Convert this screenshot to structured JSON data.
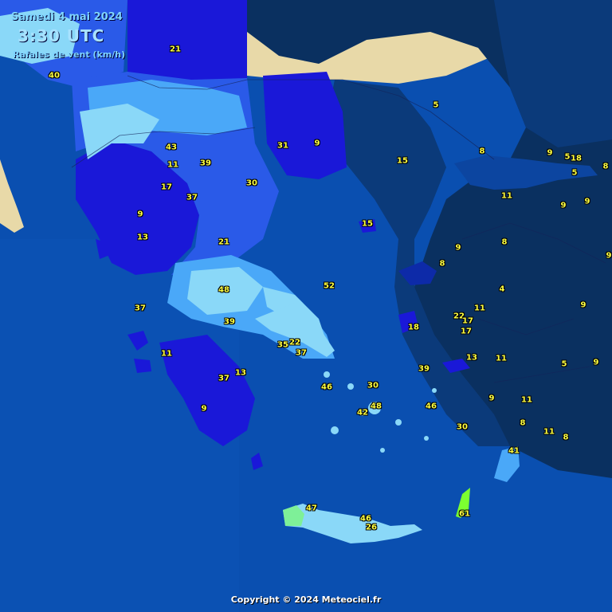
{
  "header": {
    "date": "Samedi 4 mai 2024",
    "time": "3:30 UTC",
    "variable": "Rafales de vent (km/h)"
  },
  "copyright": "Copyright © 2024 Meteociel.fr",
  "colors": {
    "sea": "#0a4fb0",
    "land_outside": "#e8d9a8",
    "very_dark_navy": "#0a3060",
    "dark_navy": "#0b3a7a",
    "navy": "#0d2aa8",
    "blue_dark": "#1a18d8",
    "blue_mid": "#2a5ae8",
    "blue_light": "#4aa8f8",
    "cyan": "#8ad8f8",
    "mint": "#7ef098",
    "green": "#7cff30",
    "label": "#ffff40"
  },
  "gust_labels": [
    {
      "v": "40"
    },
    {
      "v": "21"
    },
    {
      "v": "5"
    },
    {
      "v": "43"
    },
    {
      "v": "11"
    },
    {
      "v": "39"
    },
    {
      "v": "31"
    },
    {
      "v": "9"
    },
    {
      "v": "15"
    },
    {
      "v": "8"
    },
    {
      "v": "9"
    },
    {
      "v": "5"
    },
    {
      "v": "18"
    },
    {
      "v": "8"
    },
    {
      "v": "5"
    },
    {
      "v": "17"
    },
    {
      "v": "37"
    },
    {
      "v": "30"
    },
    {
      "v": "11"
    },
    {
      "v": "9"
    },
    {
      "v": "9"
    },
    {
      "v": "9"
    },
    {
      "v": "13"
    },
    {
      "v": "21"
    },
    {
      "v": "15"
    },
    {
      "v": "8"
    },
    {
      "v": "9"
    },
    {
      "v": "8"
    },
    {
      "v": "9"
    },
    {
      "v": "48"
    },
    {
      "v": "52"
    },
    {
      "v": "4"
    },
    {
      "v": "37"
    },
    {
      "v": "11"
    },
    {
      "v": "9"
    },
    {
      "v": "39"
    },
    {
      "v": "22"
    },
    {
      "v": "17"
    },
    {
      "v": "18"
    },
    {
      "v": "17"
    },
    {
      "v": "11"
    },
    {
      "v": "35"
    },
    {
      "v": "22"
    },
    {
      "v": "37"
    },
    {
      "v": "13"
    },
    {
      "v": "11"
    },
    {
      "v": "37"
    },
    {
      "v": "13"
    },
    {
      "v": "39"
    },
    {
      "v": "5"
    },
    {
      "v": "9"
    },
    {
      "v": "46"
    },
    {
      "v": "30"
    },
    {
      "v": "9"
    },
    {
      "v": "11"
    },
    {
      "v": "9"
    },
    {
      "v": "48"
    },
    {
      "v": "42"
    },
    {
      "v": "46"
    },
    {
      "v": "8"
    },
    {
      "v": "30"
    },
    {
      "v": "11"
    },
    {
      "v": "8"
    },
    {
      "v": "41"
    },
    {
      "v": "47"
    },
    {
      "v": "46"
    },
    {
      "v": "26"
    },
    {
      "v": "61"
    }
  ]
}
